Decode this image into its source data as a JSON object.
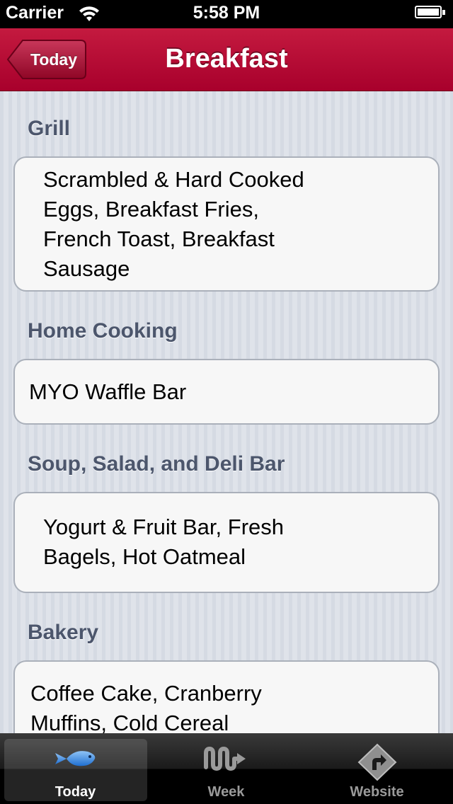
{
  "status_bar": {
    "carrier": "Carrier",
    "time": "5:58 PM"
  },
  "nav": {
    "back_label": "Today",
    "title": "Breakfast",
    "bar_color": "#b50a35"
  },
  "sections": [
    {
      "header": "Grill",
      "lines": [
        "Scrambled & Hard Cooked",
        "Eggs, Breakfast Fries,",
        "French Toast, Breakfast",
        "Sausage"
      ]
    },
    {
      "header": "Home Cooking",
      "lines": [
        "MYO Waffle Bar"
      ]
    },
    {
      "header": "Soup, Salad, and Deli Bar",
      "lines": [
        "Yogurt & Fruit Bar, Fresh",
        "Bagels, Hot Oatmeal"
      ]
    },
    {
      "header": "Bakery",
      "lines": [
        "Coffee Cake, Cranberry",
        "Muffins, Cold Cereal"
      ]
    }
  ],
  "tab_bar": {
    "tabs": [
      {
        "label": "Today",
        "icon": "fish-icon",
        "selected": true
      },
      {
        "label": "Week",
        "icon": "wave-arrow-icon",
        "selected": false
      },
      {
        "label": "Website",
        "icon": "directions-sign-icon",
        "selected": false
      }
    ],
    "accent": "#4a90d9"
  }
}
